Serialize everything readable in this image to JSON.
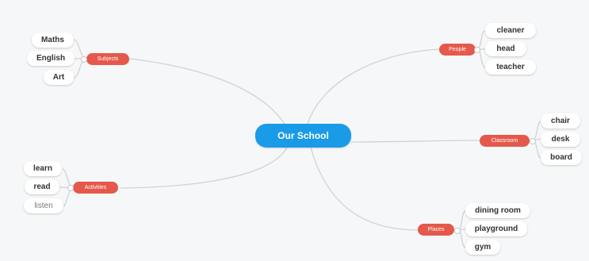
{
  "colors": {
    "central_fill": "#1a9be8",
    "branch_fill": "#e4594b",
    "link_stroke": "#cfd3d6",
    "background": "#f6f7f8"
  },
  "central_topic": {
    "label": "Our School"
  },
  "branches": [
    {
      "key": "subjects",
      "label": "Subjects",
      "leaves": [
        "Maths",
        "English",
        "Art"
      ]
    },
    {
      "key": "activities",
      "label": "Activities",
      "leaves": [
        "learn",
        "read",
        "listen"
      ]
    },
    {
      "key": "people",
      "label": "People",
      "leaves": [
        "cleaner",
        "head",
        "teacher"
      ]
    },
    {
      "key": "classroom",
      "label": "Classroom",
      "leaves": [
        "chair",
        "desk",
        "board"
      ]
    },
    {
      "key": "places",
      "label": "Places",
      "leaves": [
        "dining room",
        "playground",
        "gym"
      ]
    }
  ]
}
